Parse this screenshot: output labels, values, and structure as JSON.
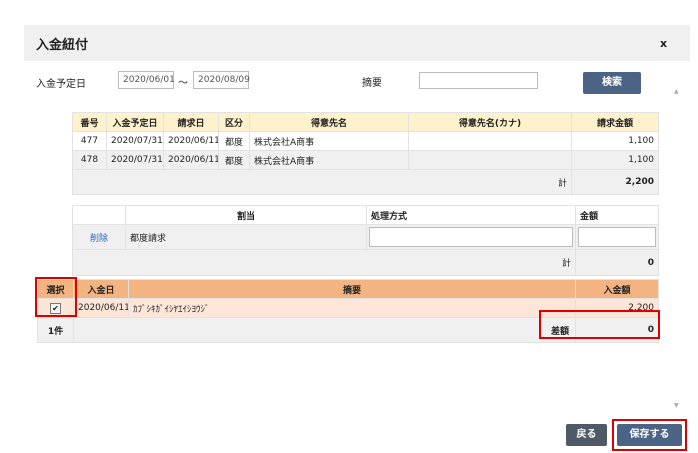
{
  "dialog": {
    "title": "入金紐付",
    "close_label": "x"
  },
  "search": {
    "date_label": "入金予定日",
    "date_from": "2020/06/01",
    "tilde": "～",
    "date_to": "2020/08/09",
    "summary_label": "摘要",
    "summary_value": "",
    "search_button": "検索"
  },
  "invoices": {
    "headers": [
      "番号",
      "入金予定日",
      "請求日",
      "区分",
      "得意先名",
      "得意先名(カナ)",
      "請求金額"
    ],
    "rows": [
      [
        "477",
        "2020/07/31",
        "2020/06/11",
        "都度",
        "株式会社A商事",
        "",
        "1,100"
      ],
      [
        "478",
        "2020/07/31",
        "2020/06/11",
        "都度",
        "株式会社A商事",
        "",
        "1,100"
      ]
    ],
    "total_label": "計",
    "total_value": "2,200"
  },
  "allocation": {
    "headers": [
      "",
      "割当",
      "処理方式",
      "金額"
    ],
    "row": {
      "delete_label": "削除",
      "allocation": "都度請求",
      "method": "",
      "amount": ""
    },
    "total_label": "計",
    "total_value": "0"
  },
  "deposits": {
    "headers": [
      "選択",
      "入金日",
      "摘要",
      "入金額"
    ],
    "row": {
      "checked": "✔",
      "date": "2020/06/11",
      "summary": "ｶﾌﾞｼｷｶﾞｲｼﾔｴｲｼﾖｳｼﾞ",
      "amount": "2,200"
    },
    "count_label": "1件",
    "diff_label": "差額",
    "diff_value": "0"
  },
  "footer": {
    "back_button": "戻る",
    "save_button": "保存する"
  },
  "colors": {
    "accent_blue": "#4b6486",
    "highlight_red": "#dd0000",
    "header_yellow": "#fdf2cc",
    "header_orange": "#f3b482"
  }
}
